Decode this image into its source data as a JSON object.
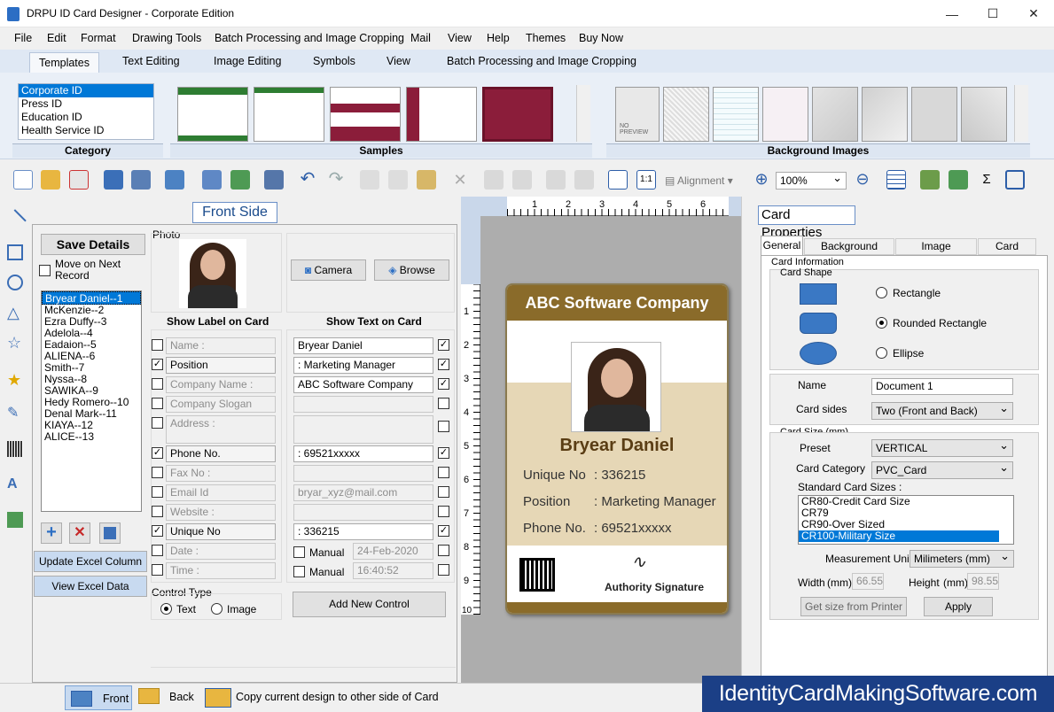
{
  "title": "DRPU ID Card Designer - Corporate Edition",
  "menu": [
    "File",
    "Edit",
    "Format",
    "Drawing Tools",
    "Batch Processing and Image Cropping",
    "Mail",
    "View",
    "Help",
    "Themes",
    "Buy Now"
  ],
  "tabs": [
    "Templates",
    "Text Editing",
    "Image Editing",
    "Symbols",
    "View",
    "Batch Processing and Image Cropping"
  ],
  "ribbon": {
    "category_label": "Category",
    "categories": [
      "Corporate ID",
      "Press ID",
      "Education ID",
      "Health Service ID"
    ],
    "samples_label": "Samples",
    "bg_label": "Background Images",
    "no_preview": "NO PREVIEW"
  },
  "toolbar": {
    "alignment": "Alignment",
    "zoom": "100%"
  },
  "front": {
    "title": "Front Side",
    "save_details": "Save Details",
    "move_next": "Move on Next Record",
    "records": [
      "Bryear Daniel--1",
      "McKenzie--2",
      "Ezra Duffy--3",
      "Adelola--4",
      "Eadaion--5",
      "ALIENA--6",
      "Smith--7",
      " Nyssa--8",
      "SAWIKA--9",
      "Hedy Romero--10",
      "Denal Mark--11",
      "KIAYA--12",
      "ALICE--13"
    ],
    "update_excel": "Update Excel Column",
    "view_excel": "View Excel Data",
    "photo": "Photo",
    "camera": "Camera",
    "browse": "Browse",
    "show_label": "Show Label on Card",
    "show_text": "Show Text on Card",
    "labels": [
      "Name :",
      "Position",
      "Company Name :",
      "Company Slogan",
      "Address :",
      "Phone No.",
      "Fax No :",
      "Email Id",
      "Website :",
      "Unique No",
      "Date :",
      "Time :"
    ],
    "texts": [
      "Bryear Daniel",
      ": Marketing Manager",
      "ABC Software Company",
      "",
      "",
      ": 69521xxxxx",
      "",
      "bryar_xyz@mail.com",
      "",
      ": 336215"
    ],
    "manual": "Manual",
    "date": "24-Feb-2020",
    "time": "16:40:52",
    "control_type": "Control Type",
    "text": "Text",
    "image": "Image",
    "add_control": "Add New Control"
  },
  "card": {
    "company": "ABC Software Company",
    "name": "Bryear Daniel",
    "rows": [
      [
        "Unique No",
        ": 336215"
      ],
      [
        "Position",
        ": Marketing Manager"
      ],
      [
        "Phone No.",
        ": 69521xxxxx"
      ]
    ],
    "signature": "Authority Signature"
  },
  "ruler": {
    "top": [
      "1",
      "2",
      "3",
      "4",
      "5",
      "6"
    ],
    "left": [
      "1",
      "2",
      "3",
      "4",
      "5",
      "6",
      "7",
      "8",
      "9",
      "10"
    ]
  },
  "props": {
    "title": "Card Properties",
    "tabs": [
      "General",
      "Background Format",
      "Image Properties",
      "Card Border"
    ],
    "card_info": "Card Information",
    "card_shape": "Card Shape",
    "shapes": [
      "Rectangle",
      "Rounded Rectangle",
      "Ellipse"
    ],
    "name_label": "Name",
    "name": "Document 1",
    "sides_label": "Card sides",
    "sides": "Two (Front and Back)",
    "size_label": "Card Size (mm)",
    "preset_label": "Preset",
    "preset": "VERTICAL",
    "category_label": "Card Category",
    "category": "PVC_Card",
    "standard_label": "Standard Card Sizes :",
    "standard": [
      "CR80-Credit Card Size",
      "CR79",
      "CR90-Over Sized",
      "CR100-Military Size"
    ],
    "measure_label": "Measurement Unit :",
    "measure": "Milimeters (mm)",
    "width_label": "Width",
    "height_label": "Height",
    "mm": "(mm)",
    "width": "66.55",
    "height": "98.55",
    "get_size": "Get size from Printer",
    "apply": "Apply"
  },
  "status": {
    "front": "Front",
    "back": "Back",
    "copy": "Copy current design to other side of Card"
  },
  "watermark": "IdentityCardMakingSoftware.com"
}
